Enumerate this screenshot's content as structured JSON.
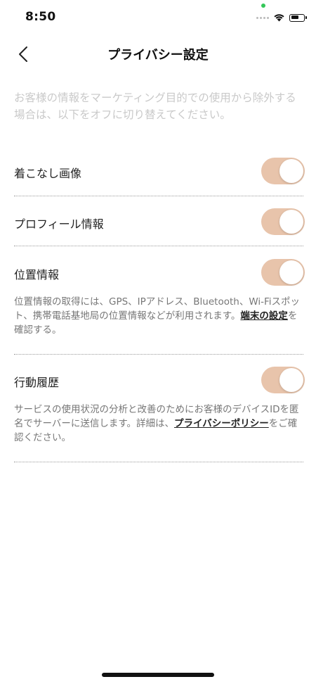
{
  "status_bar": {
    "time": "8:50",
    "icons": [
      "signal-dots-icon",
      "wifi-icon",
      "battery-icon"
    ]
  },
  "nav": {
    "back_icon": "chevron-left-icon",
    "title": "プライバシー設定"
  },
  "intro": "お客様の情報をマーケティング目的での使用から除外する場合は、以下をオフに切り替えてください。",
  "settings": [
    {
      "label": "着こなし画像",
      "enabled": true
    },
    {
      "label": "プロフィール情報",
      "enabled": true
    },
    {
      "label": "位置情報",
      "enabled": true,
      "description_prefix": "位置情報の取得には、GPS、IPアドレス、Bluetooth、Wi-Fiスポット、携帯電話基地局の位置情報などが利用されます。",
      "link_text": "端末の設定",
      "description_suffix": "を確認する。"
    },
    {
      "label": "行動履歴",
      "enabled": true,
      "description_prefix": "サービスの使用状況の分析と改善のためにお客様のデバイスIDを匿名でサーバーに送信します。詳細は、",
      "link_text": "プライバシーポリシー",
      "description_suffix": "をご確認ください。"
    }
  ],
  "colors": {
    "toggle_on": "#e8c4ab",
    "intro_text": "#c9c9c9",
    "status_dot": "#34c759"
  }
}
